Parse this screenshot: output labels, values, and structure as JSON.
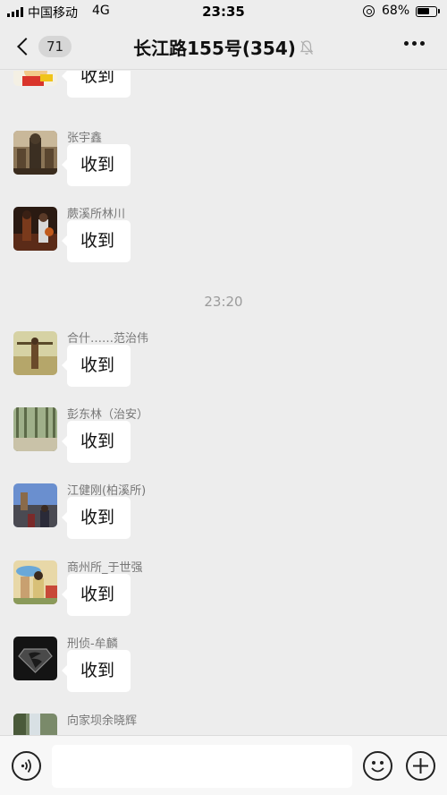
{
  "status_bar": {
    "carrier": "中国移动",
    "network": "4G",
    "time": "23:35",
    "battery_percent": "68%",
    "battery_level": 0.68
  },
  "nav": {
    "unread_count": "71",
    "title": "长江路155号(354)",
    "muted": true
  },
  "messages": [
    {
      "sender": "",
      "text": "收到",
      "avatar": "cartoon-avatar"
    },
    {
      "sender": "张宇鑫",
      "text": "收到",
      "avatar": "statue-avatar"
    },
    {
      "sender": "蕨溪所林川",
      "text": "收到",
      "avatar": "basketball-avatar"
    },
    {
      "sender": "合什……范治伟",
      "text": "收到",
      "avatar": "figure-avatar"
    },
    {
      "sender": "彭东林（治安）",
      "text": "收到",
      "avatar": "forest-avatar"
    },
    {
      "sender": "江健刚(柏溪所)",
      "text": "收到",
      "avatar": "sky-avatar"
    },
    {
      "sender": "商州所_于世强",
      "text": "收到",
      "avatar": "people-avatar"
    },
    {
      "sender": "刑侦-牟麟",
      "text": "收到",
      "avatar": "superman-avatar"
    },
    {
      "sender": "向家坝余晓辉",
      "text": "",
      "avatar": "waterfall-avatar"
    }
  ],
  "timestamp": "23:20",
  "input": {
    "value": "",
    "placeholder": ""
  },
  "colors": {
    "background": "#ededed",
    "bubble": "#ffffff",
    "sender_text": "#777777",
    "timestamp_text": "#9b9b9b"
  }
}
